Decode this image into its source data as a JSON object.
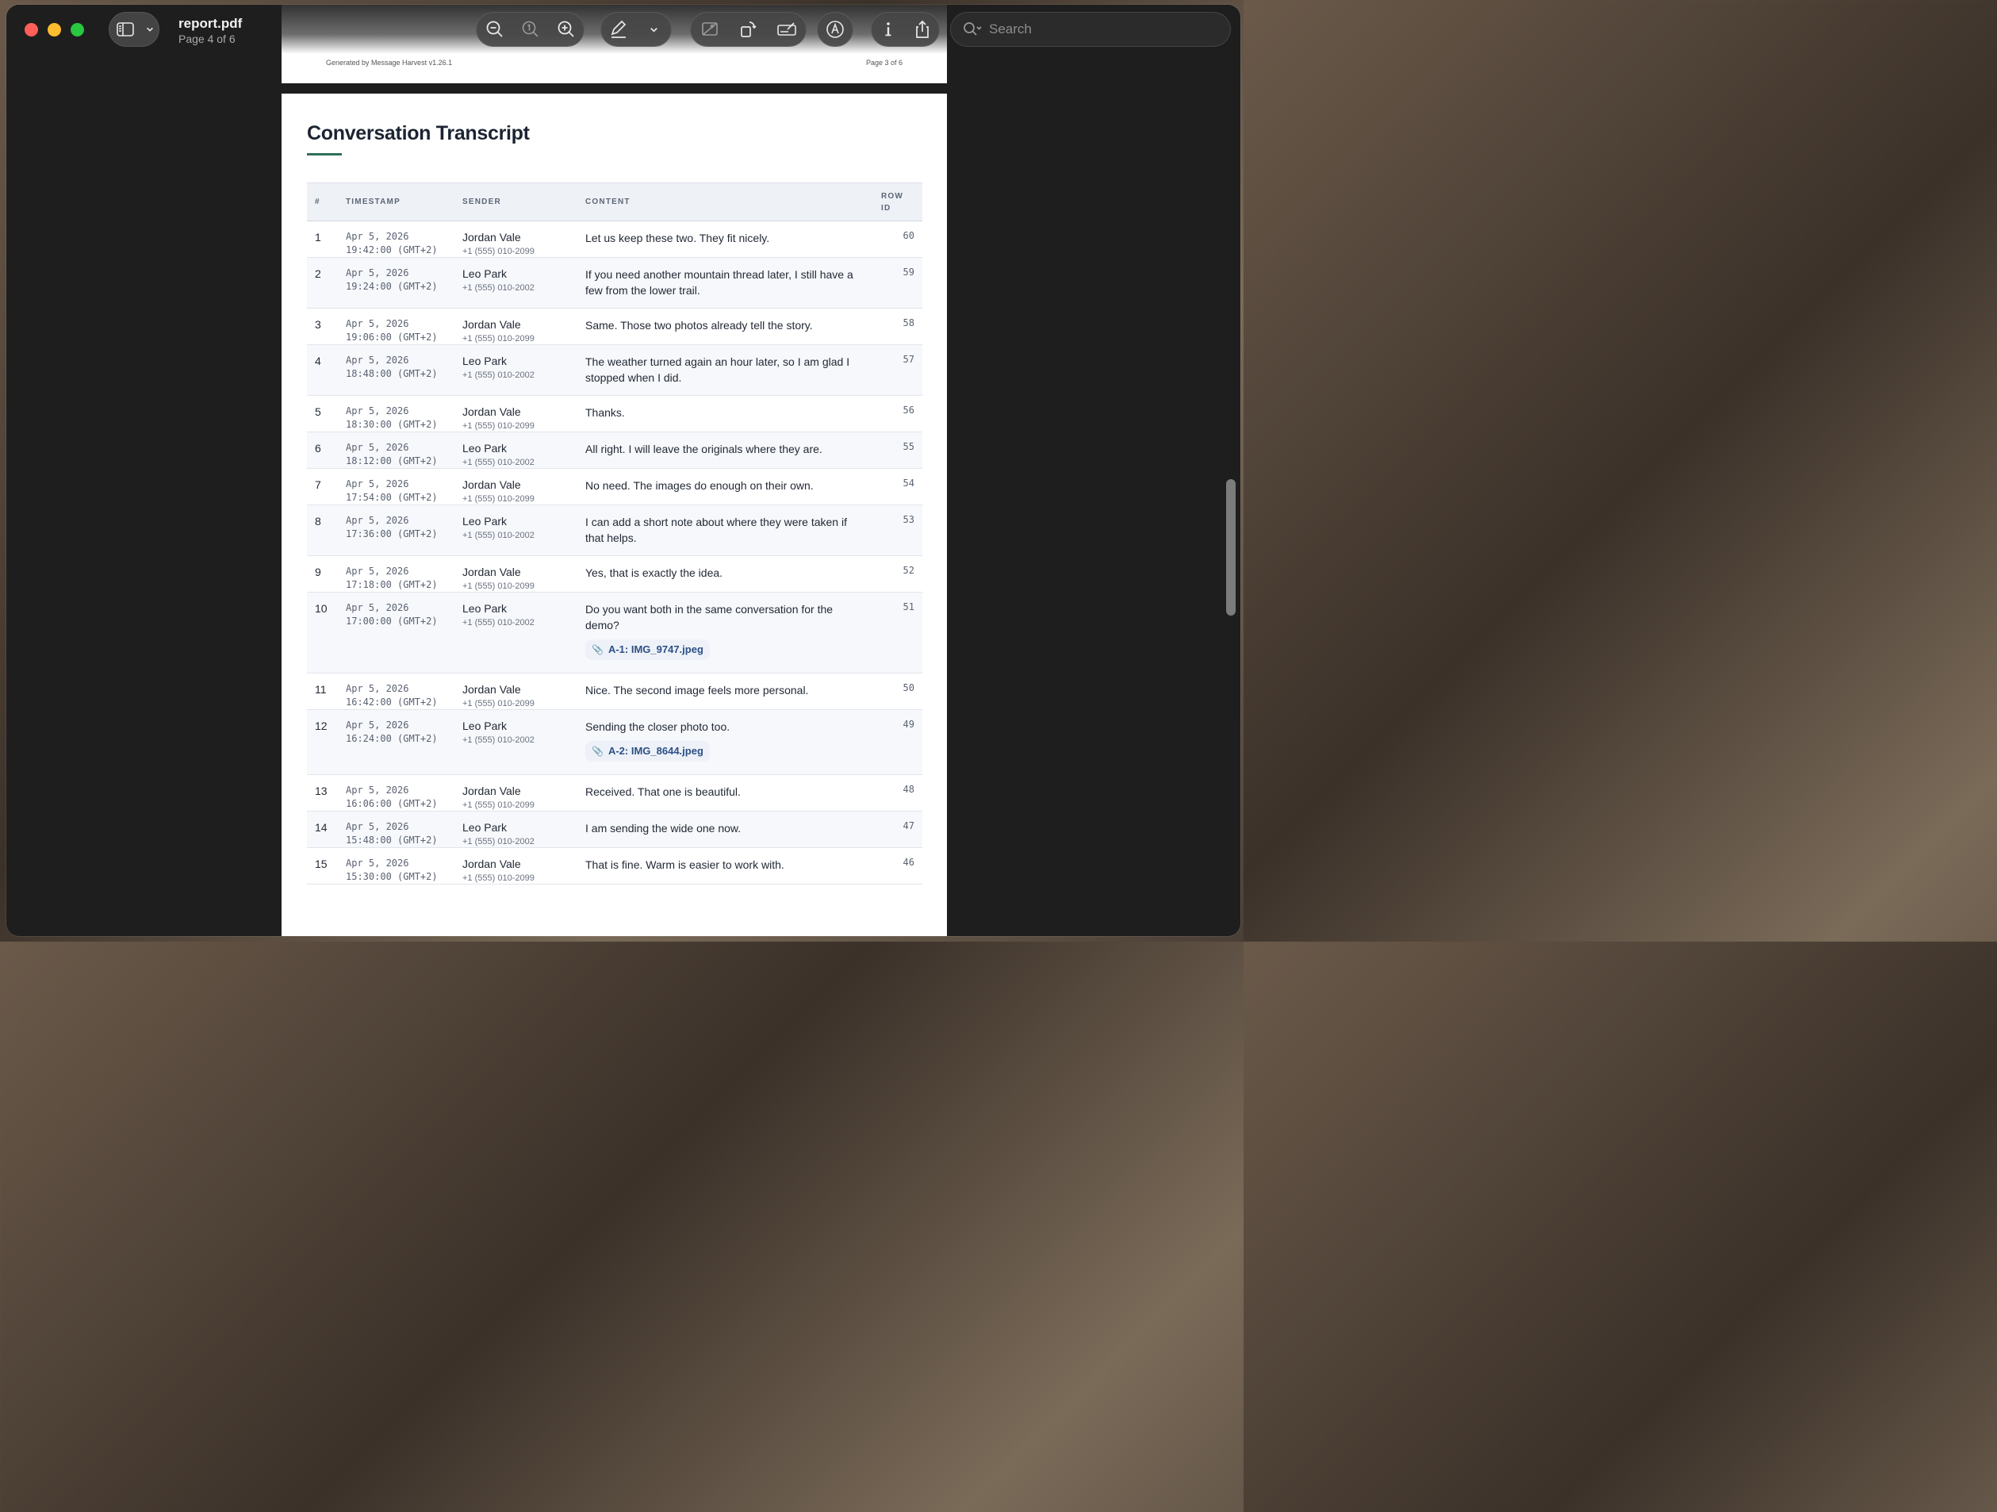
{
  "window": {
    "doc_title": "report.pdf",
    "page_indicator": "Page 4 of 6",
    "search_placeholder": "Search"
  },
  "previous_page": {
    "footer_left": "Generated by Message Harvest v1.26.1",
    "footer_right": "Page 3 of 6"
  },
  "transcript": {
    "heading": "Conversation Transcript",
    "columns": {
      "num": "#",
      "timestamp": "TIMESTAMP",
      "sender": "SENDER",
      "content": "CONTENT",
      "row_id_1": "ROW",
      "row_id_2": "ID"
    },
    "rows": [
      {
        "num": "1",
        "date": "Apr 5, 2026",
        "time": "19:42:00 (GMT+2)",
        "sender": "Jordan Vale",
        "phone": "+1 (555) 010-2099",
        "content": "Let us keep these two. They fit nicely.",
        "row_id": "60"
      },
      {
        "num": "2",
        "date": "Apr 5, 2026",
        "time": "19:24:00 (GMT+2)",
        "sender": "Leo Park",
        "phone": "+1 (555) 010-2002",
        "content": "If you need another mountain thread later, I still have a few from the lower trail.",
        "row_id": "59"
      },
      {
        "num": "3",
        "date": "Apr 5, 2026",
        "time": "19:06:00 (GMT+2)",
        "sender": "Jordan Vale",
        "phone": "+1 (555) 010-2099",
        "content": "Same. Those two photos already tell the story.",
        "row_id": "58"
      },
      {
        "num": "4",
        "date": "Apr 5, 2026",
        "time": "18:48:00 (GMT+2)",
        "sender": "Leo Park",
        "phone": "+1 (555) 010-2002",
        "content": "The weather turned again an hour later, so I am glad I stopped when I did.",
        "row_id": "57"
      },
      {
        "num": "5",
        "date": "Apr 5, 2026",
        "time": "18:30:00 (GMT+2)",
        "sender": "Jordan Vale",
        "phone": "+1 (555) 010-2099",
        "content": "Thanks.",
        "row_id": "56"
      },
      {
        "num": "6",
        "date": "Apr 5, 2026",
        "time": "18:12:00 (GMT+2)",
        "sender": "Leo Park",
        "phone": "+1 (555) 010-2002",
        "content": "All right. I will leave the originals where they are.",
        "row_id": "55"
      },
      {
        "num": "7",
        "date": "Apr 5, 2026",
        "time": "17:54:00 (GMT+2)",
        "sender": "Jordan Vale",
        "phone": "+1 (555) 010-2099",
        "content": "No need. The images do enough on their own.",
        "row_id": "54"
      },
      {
        "num": "8",
        "date": "Apr 5, 2026",
        "time": "17:36:00 (GMT+2)",
        "sender": "Leo Park",
        "phone": "+1 (555) 010-2002",
        "content": "I can add a short note about where they were taken if that helps.",
        "row_id": "53"
      },
      {
        "num": "9",
        "date": "Apr 5, 2026",
        "time": "17:18:00 (GMT+2)",
        "sender": "Jordan Vale",
        "phone": "+1 (555) 010-2099",
        "content": "Yes, that is exactly the idea.",
        "row_id": "52"
      },
      {
        "num": "10",
        "date": "Apr 5, 2026",
        "time": "17:00:00 (GMT+2)",
        "sender": "Leo Park",
        "phone": "+1 (555) 010-2002",
        "content": "Do you want both in the same conversation for the demo?",
        "attachment": "A-1: IMG_9747.jpeg",
        "row_id": "51"
      },
      {
        "num": "11",
        "date": "Apr 5, 2026",
        "time": "16:42:00 (GMT+2)",
        "sender": "Jordan Vale",
        "phone": "+1 (555) 010-2099",
        "content": "Nice. The second image feels more personal.",
        "row_id": "50"
      },
      {
        "num": "12",
        "date": "Apr 5, 2026",
        "time": "16:24:00 (GMT+2)",
        "sender": "Leo Park",
        "phone": "+1 (555) 010-2002",
        "content": "Sending the closer photo too.",
        "attachment": "A-2: IMG_8644.jpeg",
        "row_id": "49"
      },
      {
        "num": "13",
        "date": "Apr 5, 2026",
        "time": "16:06:00 (GMT+2)",
        "sender": "Jordan Vale",
        "phone": "+1 (555) 010-2099",
        "content": "Received. That one is beautiful.",
        "row_id": "48"
      },
      {
        "num": "14",
        "date": "Apr 5, 2026",
        "time": "15:48:00 (GMT+2)",
        "sender": "Leo Park",
        "phone": "+1 (555) 010-2002",
        "content": "I am sending the wide one now.",
        "row_id": "47"
      },
      {
        "num": "15",
        "date": "Apr 5, 2026",
        "time": "15:30:00 (GMT+2)",
        "sender": "Jordan Vale",
        "phone": "+1 (555) 010-2099",
        "content": "That is fine. Warm is easier to work with.",
        "row_id": "46"
      }
    ]
  }
}
